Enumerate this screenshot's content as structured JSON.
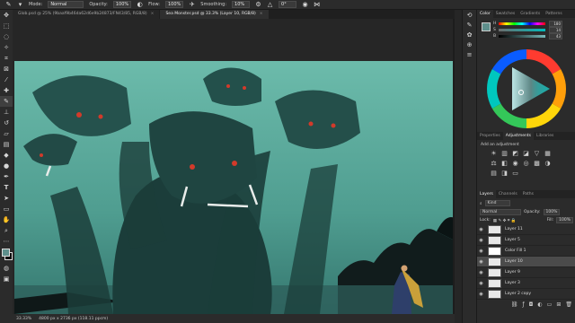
{
  "options_bar": {
    "mode_label": "Mode:",
    "mode_value": "Normal",
    "opacity_label": "Opacity:",
    "opacity_value": "100%",
    "flow_label": "Flow:",
    "flow_value": "100%",
    "smoothing_label": "Smoothing:",
    "smoothing_value": "10%",
    "angle_value": "0°"
  },
  "tabs": [
    {
      "label": "Glob.psd @ 25% (9baaf9b46da62d6e9b24873/FN43/85, RGB/8)"
    },
    {
      "label": "Sea Monster.psd @ 33.3% (Layer 10, RGB/8)"
    }
  ],
  "status": {
    "zoom": "33.33%",
    "doc_info": "4800 px x 2736 px (118.11 ppcm)"
  },
  "color_panel": {
    "tabs": [
      "Color",
      "Swatches",
      "Gradients",
      "Patterns"
    ],
    "h_label": "H",
    "h_value": "180",
    "s_label": "S",
    "s_value": "14",
    "b_label": "B",
    "b_value": "43"
  },
  "adjustments_panel": {
    "tabs": [
      "Properties",
      "Adjustments",
      "Libraries"
    ],
    "add_label": "Add an adjustment"
  },
  "layers_panel": {
    "tabs": [
      "Layers",
      "Channels",
      "Paths"
    ],
    "filter_kind": "Kind",
    "blend_mode": "Normal",
    "opacity_label": "Opacity:",
    "opacity_value": "100%",
    "lock_label": "Lock:",
    "fill_label": "Fill:",
    "fill_value": "100%",
    "layers": [
      {
        "name": "Layer 11"
      },
      {
        "name": "Layer 5"
      },
      {
        "name": "Color Fill 1"
      },
      {
        "name": "Layer 10"
      },
      {
        "name": "Layer 9"
      },
      {
        "name": "Layer 3"
      },
      {
        "name": "Layer 2 copy"
      }
    ]
  },
  "colors": {
    "sky": "#5fb0a2",
    "accent_eye": "#d23a2a",
    "ui_bg": "#2b2b2b"
  }
}
